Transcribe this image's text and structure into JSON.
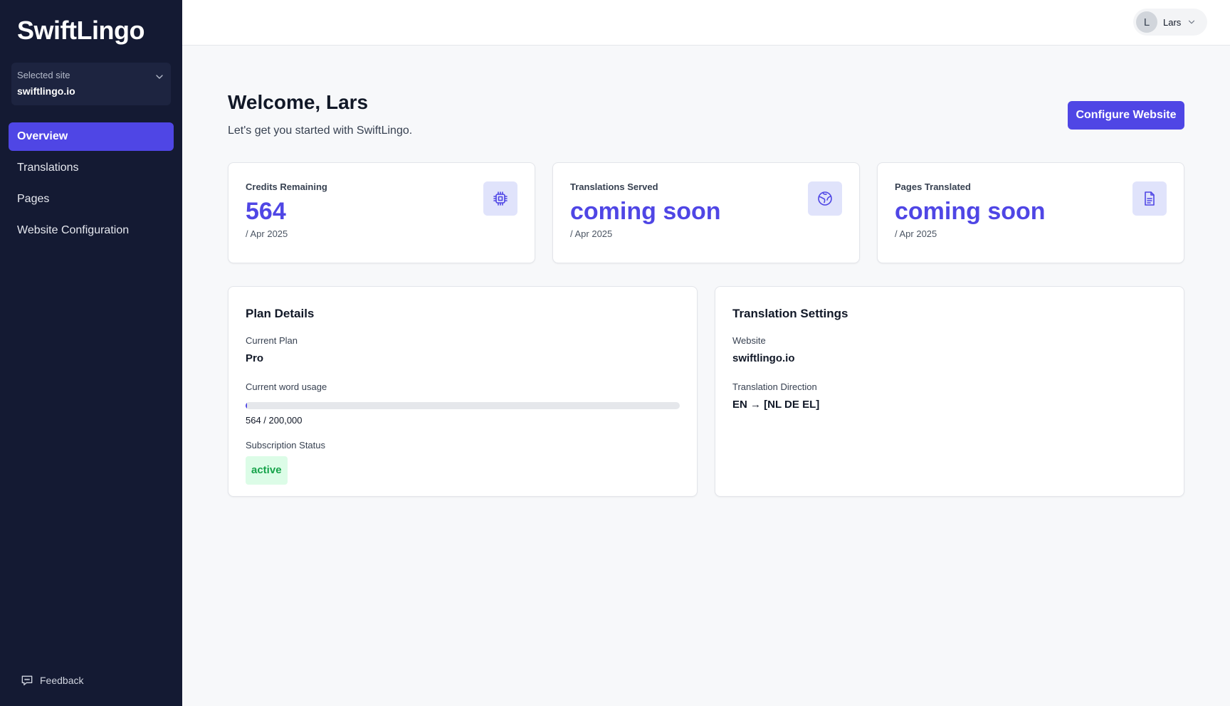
{
  "sidebar": {
    "brand": "SwiftLingo",
    "site_selector": {
      "label": "Selected site",
      "value": "swiftlingo.io",
      "icon": "chevron-down-icon"
    },
    "nav": [
      {
        "label": "Overview",
        "active": true
      },
      {
        "label": "Translations",
        "active": false
      },
      {
        "label": "Pages",
        "active": false
      },
      {
        "label": "Website Configuration",
        "active": false
      }
    ],
    "feedback": {
      "label": "Feedback",
      "icon": "chat-bubble-icon"
    }
  },
  "header": {
    "user": {
      "initial": "L",
      "name": "Lars",
      "icon": "chevron-down-icon"
    }
  },
  "main": {
    "welcome": "Welcome, Lars",
    "subtitle": "Let's get you started with SwiftLingo.",
    "configure_button": "Configure Website",
    "stats": [
      {
        "label": "Credits Remaining",
        "value": "564",
        "period": "/ Apr 2025",
        "icon": "chip-icon"
      },
      {
        "label": "Translations Served",
        "value": "coming soon",
        "period": "/ Apr 2025",
        "icon": "globe-icon"
      },
      {
        "label": "Pages Translated",
        "value": "coming soon",
        "period": "/ Apr 2025",
        "icon": "document-icon"
      }
    ],
    "plan": {
      "title": "Plan Details",
      "current_plan_label": "Current Plan",
      "current_plan": "Pro",
      "usage_label": "Current word usage",
      "usage_text": "564 / 200,000",
      "usage_fraction": 0.00282,
      "status_label": "Subscription Status",
      "status": "active"
    },
    "translation_settings": {
      "title": "Translation Settings",
      "website_label": "Website",
      "website": "swiftlingo.io",
      "direction_label": "Translation Direction",
      "direction": "EN → [NL DE EL]"
    }
  },
  "colors": {
    "accent": "#4f46e5",
    "sidebar_bg": "#141a33",
    "status_active_bg": "#dcfce7",
    "status_active_text": "#16a34a"
  }
}
